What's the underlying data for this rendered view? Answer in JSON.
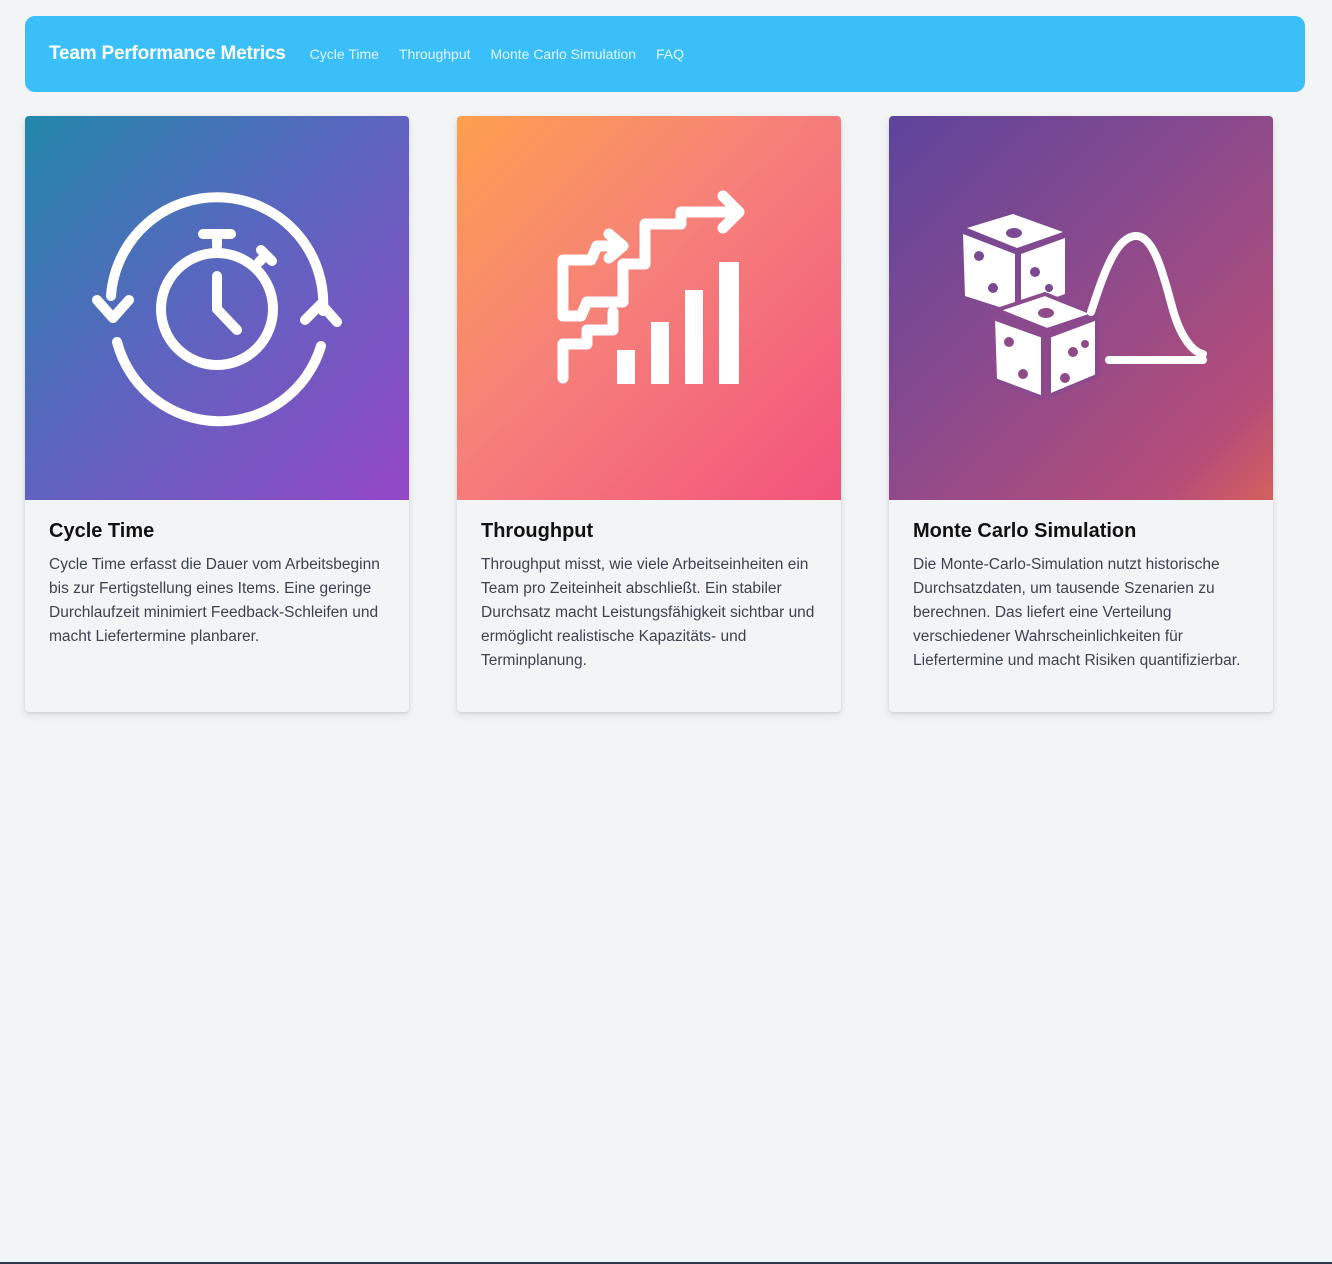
{
  "header": {
    "brand": "Team Performance Metrics",
    "nav": [
      {
        "label": "Cycle Time"
      },
      {
        "label": "Throughput"
      },
      {
        "label": "Monte Carlo Simulation"
      },
      {
        "label": "FAQ"
      }
    ]
  },
  "cards": [
    {
      "icon": "stopwatch-cycle-icon",
      "title": "Cycle Time",
      "text": "Cycle Time erfasst die Dauer vom Arbeitsbeginn bis zur Fertigstellung eines Items. Eine geringe Durchlaufzeit minimiert Feedback-Schleifen und macht Liefertermine planbarer."
    },
    {
      "icon": "throughput-chart-icon",
      "title": "Throughput",
      "text": "Throughput misst, wie viele Arbeitseinheiten ein Team pro Zeiteinheit abschließt. Ein stabiler Durchsatz macht Leistungsfähigkeit sichtbar und ermöglicht realistische Kapazitäts- und Terminplanung."
    },
    {
      "icon": "dice-distribution-icon",
      "title": "Monte Carlo Simulation",
      "text": "Die Monte-Carlo-Simulation nutzt historische Durchsatzdaten, um tausende Szenarien zu berechnen. Das liefert eine Verteilung verschiedener Wahrscheinlichkeiten für Liefertermine und macht Risiken quantifizierbar."
    }
  ],
  "colors": {
    "navbar": "#3bbff9",
    "page_background": "#f2f4f6"
  }
}
